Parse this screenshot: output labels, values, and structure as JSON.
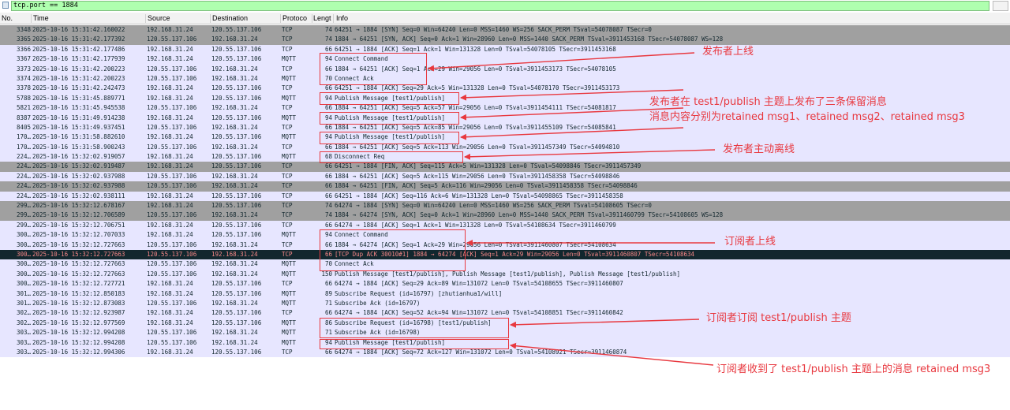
{
  "filter": {
    "value": "tcp.port == 1884"
  },
  "columns": {
    "no": "No.",
    "time": "Time",
    "source": "Source",
    "destination": "Destination",
    "protocol": "Protoco",
    "length": "Lengt",
    "info": "Info"
  },
  "colors": {
    "tcp_row": "#e7e6ff",
    "flag_row": "#a0a0a0",
    "selected_row": "#12272e",
    "selected_text": "#f78787",
    "annotation": "#e8383f",
    "filter_ok": "#afffaf"
  },
  "packets": [
    {
      "no": "3348",
      "time": "2025-10-16 15:31:42.160022",
      "src": "192.168.31.24",
      "dst": "120.55.137.106",
      "proto": "TCP",
      "len": "74",
      "info": "64251 → 1884 [SYN] Seq=0 Win=64240 Len=0 MSS=1460 WS=256 SACK_PERM TSval=54078087 TSecr=0",
      "style": "flag"
    },
    {
      "no": "3365",
      "time": "2025-10-16 15:31:42.177392",
      "src": "120.55.137.106",
      "dst": "192.168.31.24",
      "proto": "TCP",
      "len": "74",
      "info": "1884 → 64251 [SYN, ACK] Seq=0 Ack=1 Win=28960 Len=0 MSS=1440 SACK_PERM TSval=3911453168 TSecr=54078087 WS=128",
      "style": "flag"
    },
    {
      "no": "3366",
      "time": "2025-10-16 15:31:42.177486",
      "src": "192.168.31.24",
      "dst": "120.55.137.106",
      "proto": "TCP",
      "len": "66",
      "info": "64251 → 1884 [ACK] Seq=1 Ack=1 Win=131328 Len=0 TSval=54078105 TSecr=3911453168",
      "style": "tcp"
    },
    {
      "no": "3367",
      "time": "2025-10-16 15:31:42.177939",
      "src": "192.168.31.24",
      "dst": "120.55.137.106",
      "proto": "MQTT",
      "len": "94",
      "info": "Connect Command",
      "style": "tcp"
    },
    {
      "no": "3373",
      "time": "2025-10-16 15:31:42.200223",
      "src": "120.55.137.106",
      "dst": "192.168.31.24",
      "proto": "TCP",
      "len": "66",
      "info": "1884 → 64251 [ACK] Seq=1 Ack=29 Win=29056 Len=0 TSval=3911453173 TSecr=54078105",
      "style": "tcp"
    },
    {
      "no": "3374",
      "time": "2025-10-16 15:31:42.200223",
      "src": "120.55.137.106",
      "dst": "192.168.31.24",
      "proto": "MQTT",
      "len": "70",
      "info": "Connect Ack",
      "style": "tcp"
    },
    {
      "no": "3378",
      "time": "2025-10-16 15:31:42.242473",
      "src": "192.168.31.24",
      "dst": "120.55.137.106",
      "proto": "TCP",
      "len": "66",
      "info": "64251 → 1884 [ACK] Seq=29 Ack=5 Win=131328 Len=0 TSval=54078170 TSecr=3911453173",
      "style": "tcp"
    },
    {
      "no": "5788",
      "time": "2025-10-16 15:31:45.889771",
      "src": "192.168.31.24",
      "dst": "120.55.137.106",
      "proto": "MQTT",
      "len": "94",
      "info": "Publish Message [test1/publish]",
      "style": "tcp"
    },
    {
      "no": "5821",
      "time": "2025-10-16 15:31:45.945538",
      "src": "120.55.137.106",
      "dst": "192.168.31.24",
      "proto": "TCP",
      "len": "66",
      "info": "1884 → 64251 [ACK] Seq=5 Ack=57 Win=29056 Len=0 TSval=3911454111 TSecr=54081817",
      "style": "tcp"
    },
    {
      "no": "8387",
      "time": "2025-10-16 15:31:49.914238",
      "src": "192.168.31.24",
      "dst": "120.55.137.106",
      "proto": "MQTT",
      "len": "94",
      "info": "Publish Message [test1/publish]",
      "style": "tcp"
    },
    {
      "no": "8405",
      "time": "2025-10-16 15:31:49.937451",
      "src": "120.55.137.106",
      "dst": "192.168.31.24",
      "proto": "TCP",
      "len": "66",
      "info": "1884 → 64251 [ACK] Seq=5 Ack=85 Win=29056 Len=0 TSval=3911455109 TSecr=54085841",
      "style": "tcp"
    },
    {
      "no": "170…",
      "time": "2025-10-16 15:31:58.882610",
      "src": "192.168.31.24",
      "dst": "120.55.137.106",
      "proto": "MQTT",
      "len": "94",
      "info": "Publish Message [test1/publish]",
      "style": "tcp"
    },
    {
      "no": "170…",
      "time": "2025-10-16 15:31:58.900243",
      "src": "120.55.137.106",
      "dst": "192.168.31.24",
      "proto": "TCP",
      "len": "66",
      "info": "1884 → 64251 [ACK] Seq=5 Ack=113 Win=29056 Len=0 TSval=3911457349 TSecr=54094810",
      "style": "tcp"
    },
    {
      "no": "224…",
      "time": "2025-10-16 15:32:02.919057",
      "src": "192.168.31.24",
      "dst": "120.55.137.106",
      "proto": "MQTT",
      "len": "68",
      "info": "Disconnect Req",
      "style": "tcp"
    },
    {
      "no": "224…",
      "time": "2025-10-16 15:32:02.919487",
      "src": "192.168.31.24",
      "dst": "120.55.137.106",
      "proto": "TCP",
      "len": "66",
      "info": "64251 → 1884 [FIN, ACK] Seq=115 Ack=5 Win=131328 Len=0 TSval=54098846 TSecr=3911457349",
      "style": "flag"
    },
    {
      "no": "224…",
      "time": "2025-10-16 15:32:02.937988",
      "src": "120.55.137.106",
      "dst": "192.168.31.24",
      "proto": "TCP",
      "len": "66",
      "info": "1884 → 64251 [ACK] Seq=5 Ack=115 Win=29056 Len=0 TSval=3911458358 TSecr=54098846",
      "style": "tcp"
    },
    {
      "no": "224…",
      "time": "2025-10-16 15:32:02.937988",
      "src": "120.55.137.106",
      "dst": "192.168.31.24",
      "proto": "TCP",
      "len": "66",
      "info": "1884 → 64251 [FIN, ACK] Seq=5 Ack=116 Win=29056 Len=0 TSval=3911458358 TSecr=54098846",
      "style": "flag"
    },
    {
      "no": "224…",
      "time": "2025-10-16 15:32:02.938111",
      "src": "192.168.31.24",
      "dst": "120.55.137.106",
      "proto": "TCP",
      "len": "66",
      "info": "64251 → 1884 [ACK] Seq=116 Ack=6 Win=131328 Len=0 TSval=54098865 TSecr=3911458358",
      "style": "tcp"
    },
    {
      "no": "299…",
      "time": "2025-10-16 15:32:12.678167",
      "src": "192.168.31.24",
      "dst": "120.55.137.106",
      "proto": "TCP",
      "len": "74",
      "info": "64274 → 1884 [SYN] Seq=0 Win=64240 Len=0 MSS=1460 WS=256 SACK_PERM TSval=54108605 TSecr=0",
      "style": "flag"
    },
    {
      "no": "299…",
      "time": "2025-10-16 15:32:12.706589",
      "src": "120.55.137.106",
      "dst": "192.168.31.24",
      "proto": "TCP",
      "len": "74",
      "info": "1884 → 64274 [SYN, ACK] Seq=0 Ack=1 Win=28960 Len=0 MSS=1440 SACK_PERM TSval=3911460799 TSecr=54108605 WS=128",
      "style": "flag"
    },
    {
      "no": "299…",
      "time": "2025-10-16 15:32:12.706751",
      "src": "192.168.31.24",
      "dst": "120.55.137.106",
      "proto": "TCP",
      "len": "66",
      "info": "64274 → 1884 [ACK] Seq=1 Ack=1 Win=131328 Len=0 TSval=54108634 TSecr=3911460799",
      "style": "tcp"
    },
    {
      "no": "300…",
      "time": "2025-10-16 15:32:12.707033",
      "src": "192.168.31.24",
      "dst": "120.55.137.106",
      "proto": "MQTT",
      "len": "94",
      "info": "Connect Command",
      "style": "tcp"
    },
    {
      "no": "300…",
      "time": "2025-10-16 15:32:12.727663",
      "src": "120.55.137.106",
      "dst": "192.168.31.24",
      "proto": "TCP",
      "len": "66",
      "info": "1884 → 64274 [ACK] Seq=1 Ack=29 Win=29056 Len=0 TSval=3911460807 TSecr=54108634",
      "style": "tcp"
    },
    {
      "no": "300…",
      "time": "2025-10-16 15:32:12.727663",
      "src": "120.55.137.106",
      "dst": "192.168.31.24",
      "proto": "TCP",
      "len": "66",
      "info": "[TCP Dup ACK 30010#1] 1884 → 64274 [ACK] Seq=1 Ack=29 Win=29056 Len=0 TSval=3911460807 TSecr=54108634",
      "style": "sel"
    },
    {
      "no": "300…",
      "time": "2025-10-16 15:32:12.727663",
      "src": "120.55.137.106",
      "dst": "192.168.31.24",
      "proto": "MQTT",
      "len": "70",
      "info": "Connect Ack",
      "style": "tcp"
    },
    {
      "no": "300…",
      "time": "2025-10-16 15:32:12.727663",
      "src": "120.55.137.106",
      "dst": "192.168.31.24",
      "proto": "MQTT",
      "len": "150",
      "info": "Publish Message [test1/publish], Publish Message [test1/publish], Publish Message [test1/publish]",
      "style": "tcp"
    },
    {
      "no": "300…",
      "time": "2025-10-16 15:32:12.727721",
      "src": "192.168.31.24",
      "dst": "120.55.137.106",
      "proto": "TCP",
      "len": "66",
      "info": "64274 → 1884 [ACK] Seq=29 Ack=89 Win=131072 Len=0 TSval=54108655 TSecr=3911460807",
      "style": "tcp"
    },
    {
      "no": "301…",
      "time": "2025-10-16 15:32:12.850183",
      "src": "192.168.31.24",
      "dst": "120.55.137.106",
      "proto": "MQTT",
      "len": "89",
      "info": "Subscribe Request (id=16797) [zhutianhua1/will]",
      "style": "tcp"
    },
    {
      "no": "301…",
      "time": "2025-10-16 15:32:12.873083",
      "src": "120.55.137.106",
      "dst": "192.168.31.24",
      "proto": "MQTT",
      "len": "71",
      "info": "Subscribe Ack (id=16797)",
      "style": "tcp"
    },
    {
      "no": "302…",
      "time": "2025-10-16 15:32:12.923987",
      "src": "192.168.31.24",
      "dst": "120.55.137.106",
      "proto": "TCP",
      "len": "66",
      "info": "64274 → 1884 [ACK] Seq=52 Ack=94 Win=131072 Len=0 TSval=54108851 TSecr=3911460842",
      "style": "tcp"
    },
    {
      "no": "302…",
      "time": "2025-10-16 15:32:12.977569",
      "src": "192.168.31.24",
      "dst": "120.55.137.106",
      "proto": "MQTT",
      "len": "86",
      "info": "Subscribe Request (id=16798) [test1/publish]",
      "style": "tcp"
    },
    {
      "no": "303…",
      "time": "2025-10-16 15:32:12.994208",
      "src": "120.55.137.106",
      "dst": "192.168.31.24",
      "proto": "MQTT",
      "len": "71",
      "info": "Subscribe Ack (id=16798)",
      "style": "tcp"
    },
    {
      "no": "303…",
      "time": "2025-10-16 15:32:12.994208",
      "src": "120.55.137.106",
      "dst": "192.168.31.24",
      "proto": "MQTT",
      "len": "94",
      "info": "Publish Message [test1/publish]",
      "style": "tcp"
    },
    {
      "no": "303…",
      "time": "2025-10-16 15:32:12.994306",
      "src": "192.168.31.24",
      "dst": "120.55.137.106",
      "proto": "TCP",
      "len": "66",
      "info": "64274 → 1884 [ACK] Seq=72 Ack=127 Win=131072 Len=0 TSval=54108921 TSecr=3911460874",
      "style": "tcp"
    }
  ],
  "annotations": {
    "publisher_online": "发布者上线",
    "published_line1": "发布者在 test1/publish 主题上发布了三条保留消息",
    "published_line2": "消息内容分别为retained msg1、retained msg2、retained msg3",
    "publisher_offline": "发布者主动离线",
    "subscriber_online": "订阅者上线",
    "subscriber_subscribed": "订阅者订阅 test1/publish 主题",
    "subscriber_received": "订阅者收到了 test1/publish 主题上的消息 retained msg3"
  }
}
